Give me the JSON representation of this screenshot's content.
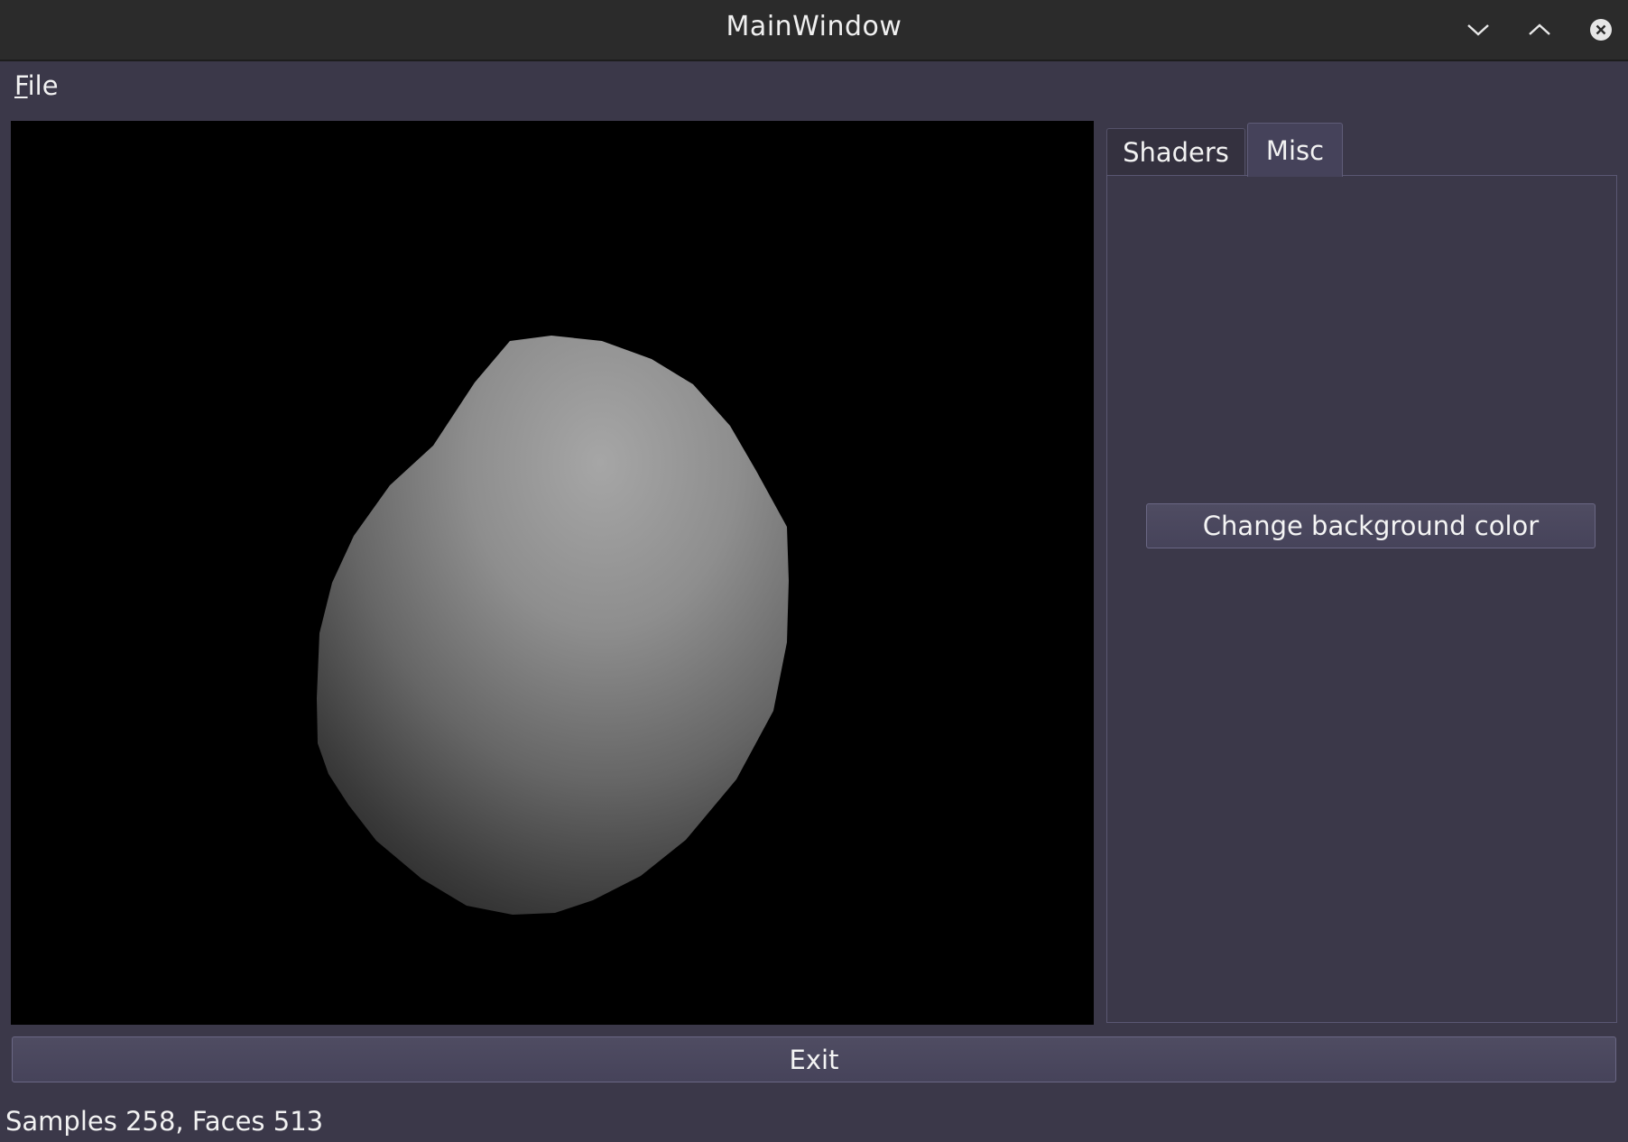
{
  "window": {
    "title": "MainWindow",
    "controls": {
      "minimize_icon": "chevron-down-icon",
      "maximize_icon": "chevron-up-icon",
      "close_icon": "close-circle-icon"
    }
  },
  "menubar": {
    "items": [
      {
        "label": "File",
        "mnemonic": "F",
        "rest": "ile"
      }
    ]
  },
  "viewport": {
    "background_color": "#000000",
    "object": "shaded-sphere"
  },
  "tabs": {
    "items": [
      {
        "label": "Shaders",
        "selected": false
      },
      {
        "label": "Misc",
        "selected": true
      }
    ]
  },
  "misc_panel": {
    "change_bg_label": "Change background color"
  },
  "actions": {
    "exit_label": "Exit"
  },
  "status": {
    "text": "Samples 258, Faces 513"
  },
  "colors": {
    "window_bg": "#3b3849",
    "titlebar_bg": "#2b2b2b",
    "button_bg": "#4b485e"
  }
}
